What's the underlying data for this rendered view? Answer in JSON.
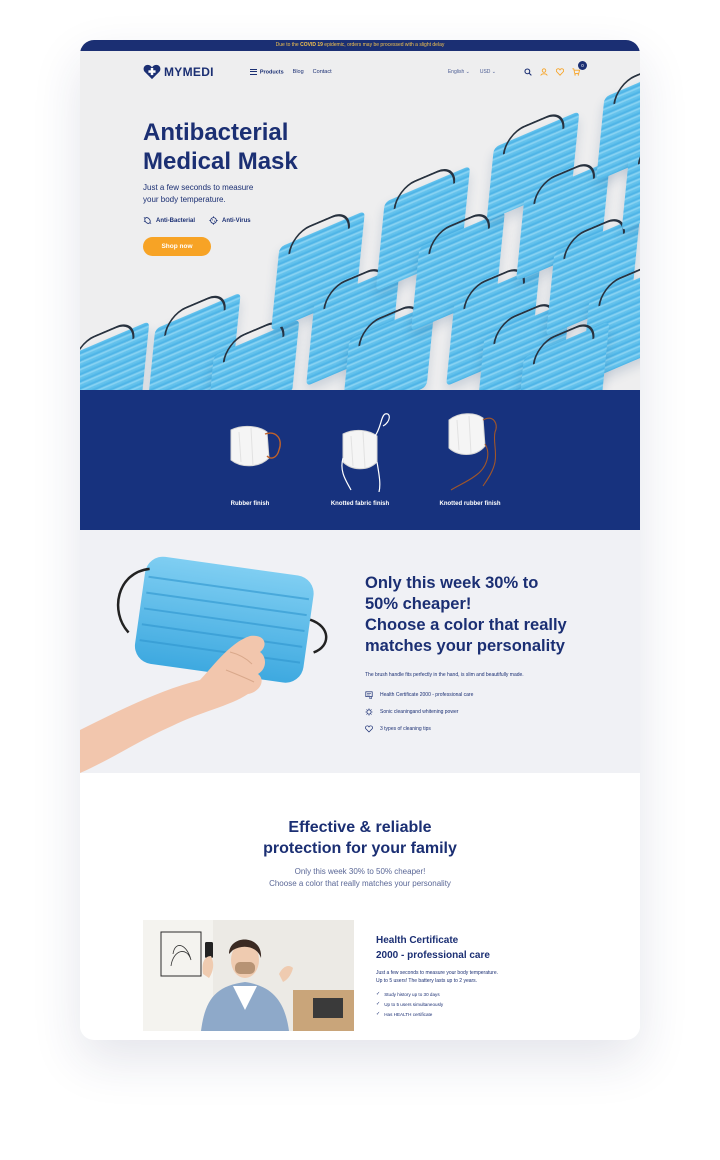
{
  "announcement": {
    "before": "Due to the ",
    "highlight": "COVID 19",
    "after": " epidemic, orders may be processed with a slight delay"
  },
  "nav": {
    "logo": "MYMEDI",
    "menu": [
      "Products",
      "Blog",
      "Contact"
    ],
    "language": "English",
    "currency": "USD",
    "cart_count": "0"
  },
  "hero": {
    "title_line1": "Antibacterial",
    "title_line2": "Medical Mask",
    "subtitle": "Just a few seconds to measure your body temperature.",
    "features": [
      "Anti-Bacterial",
      "Anti-Virus"
    ],
    "cta": "Shop now"
  },
  "finishes": [
    "Rubber finish",
    "Knotted fabric finish",
    "Knotted rubber finish"
  ],
  "promo": {
    "title_line1": "Only this week 30% to",
    "title_line2": "50% cheaper!",
    "title_line3": "Choose a color that really",
    "title_line4": "matches your personality",
    "description": "The brush handle fits perfectly in the hand, is slim and beautifully made.",
    "items": [
      "Health Certificate 2000 - professional care",
      "Sonic cleaningand whitening power",
      "3 types of cleaning tips"
    ]
  },
  "protection": {
    "title_line1": "Effective & reliable",
    "title_line2": "protection for your family",
    "sub_line1": "Only this week 30% to 50% cheaper!",
    "sub_line2": "Choose a color that really matches your personality"
  },
  "certificate": {
    "title_line1": "Health Certificate",
    "title_line2": "2000 - professional care",
    "desc_line1": "Just a few seconds to measure your body temperature.",
    "desc_line2": "Up to 5 users! The battery lasts up to 2 years.",
    "items": [
      "Study history up to 30 days",
      "Up to 5 users simultaneously",
      "Has HEALTH certificate"
    ]
  },
  "colors": {
    "navy": "#1b2f73",
    "accent": "#f7a325",
    "mask_blue": "#5bbdea"
  }
}
